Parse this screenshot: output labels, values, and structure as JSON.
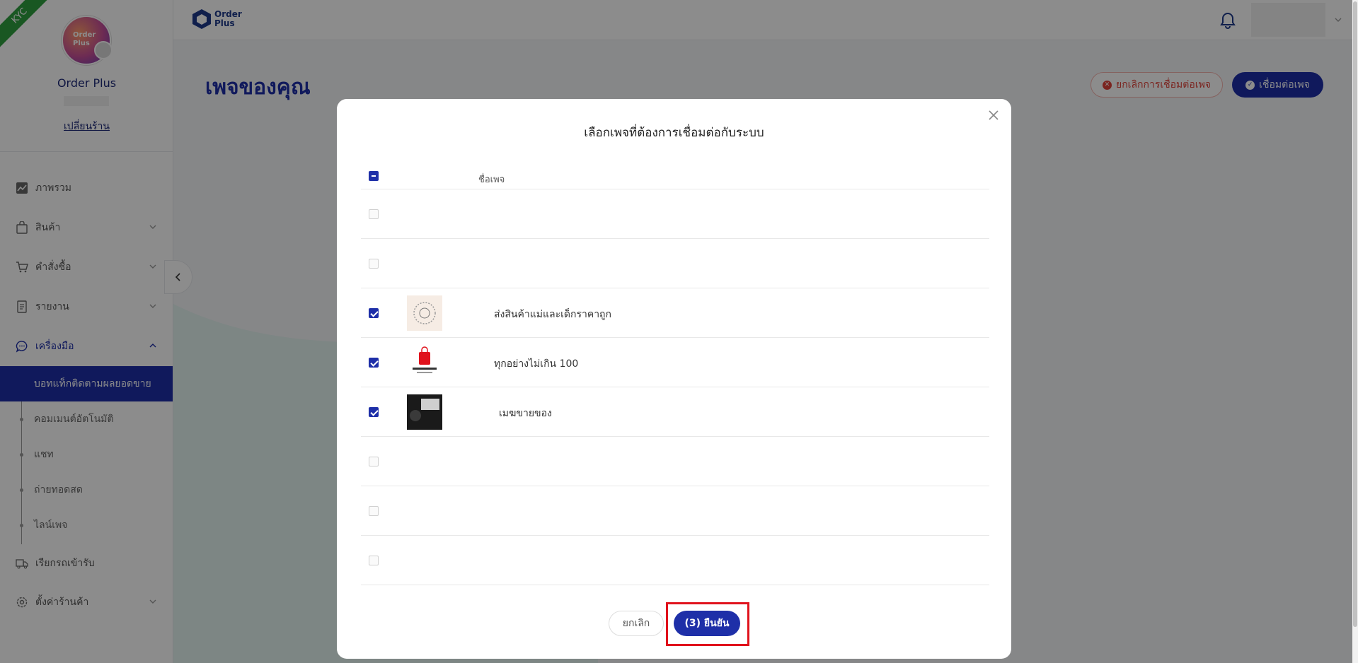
{
  "sidebar": {
    "kyc_label": "KYC",
    "avatar_text": "Order Plus",
    "shop_name": "Order Plus",
    "switch_shop": "เปลี่ยนร้าน",
    "items": [
      {
        "label": "ภาพรวม",
        "icon": "chart-icon"
      },
      {
        "label": "สินค้า",
        "icon": "bag-icon"
      },
      {
        "label": "คำสั่งซื้อ",
        "icon": "cart-icon"
      },
      {
        "label": "รายงาน",
        "icon": "report-icon"
      },
      {
        "label": "เครื่องมือ",
        "icon": "chat-icon"
      },
      {
        "label": "เรียกรถเข้ารับ",
        "icon": "truck-icon"
      },
      {
        "label": "ตั้งค่าร้านค้า",
        "icon": "gear-icon"
      }
    ],
    "tool_subitems": [
      {
        "label": "บอทแท็กติดตามผลยอดขาย"
      },
      {
        "label": "คอมเมนต์อัตโนมัติ"
      },
      {
        "label": "แชท"
      },
      {
        "label": "ถ่ายทอดสด"
      },
      {
        "label": "ไลน์เพจ"
      }
    ]
  },
  "topbar": {
    "brand_line1": "Order",
    "brand_line2": "Plus"
  },
  "main": {
    "title": "เพจของคุณ",
    "cancel_connect_label": "ยกเลิกการเชื่อมต่อเพจ",
    "connect_label": "เชื่อมต่อเพจ"
  },
  "modal": {
    "title": "เลือกเพจที่ต้องการเชื่อมต่อกับระบบ",
    "column_name": "ชื่อเพจ",
    "rows": [
      {
        "name": "",
        "checked": false,
        "disabled": true
      },
      {
        "name": "",
        "checked": false,
        "disabled": true
      },
      {
        "name": "ส่งสินค้าแม่และเด็กราคาถูก",
        "checked": true,
        "disabled": false
      },
      {
        "name": "ทุกอย่างไม่เกิน 100",
        "checked": true,
        "disabled": false
      },
      {
        "name": "เมฆขายของ",
        "checked": true,
        "disabled": false
      },
      {
        "name": "",
        "checked": false,
        "disabled": true
      },
      {
        "name": "",
        "checked": false,
        "disabled": true
      },
      {
        "name": "",
        "checked": false,
        "disabled": true
      }
    ],
    "cancel_label": "ยกเลิก",
    "confirm_label": "(3) ยืนยัน"
  },
  "colors": {
    "primary": "#1e2fa8",
    "danger": "#e0433a",
    "kyc_green": "#2e9e3e",
    "highlight_red": "#e0121c"
  }
}
